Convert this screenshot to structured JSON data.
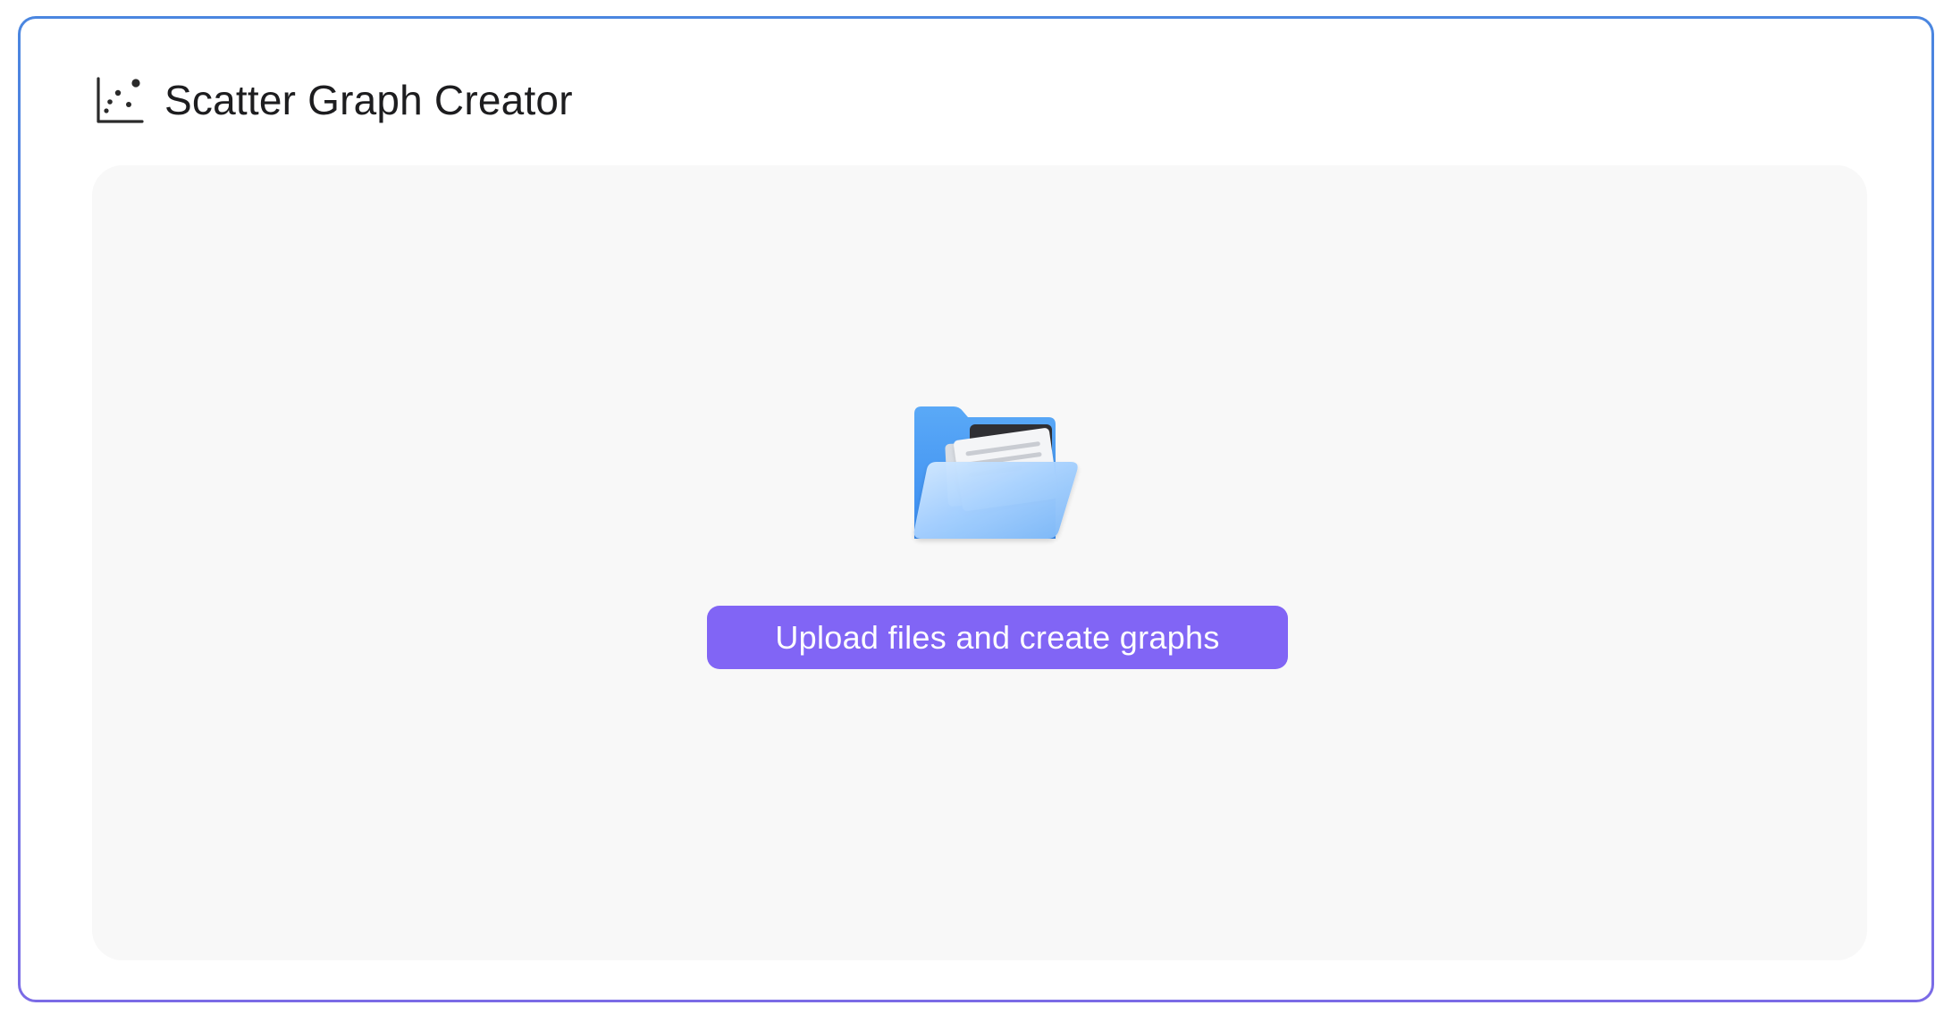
{
  "app": {
    "title": "Scatter Graph Creator",
    "icon": "scatter-chart-icon"
  },
  "upload": {
    "illustration": "open-folder-with-documents-icon",
    "button_label": "Upload files and create graphs"
  },
  "colors": {
    "frame_border_top": "#4a86e0",
    "frame_border_bottom": "#7b6be6",
    "panel_background": "#f8f8f8",
    "button_background": "#8165f5",
    "button_text": "#ffffff",
    "title_text": "#1d1d1f"
  }
}
